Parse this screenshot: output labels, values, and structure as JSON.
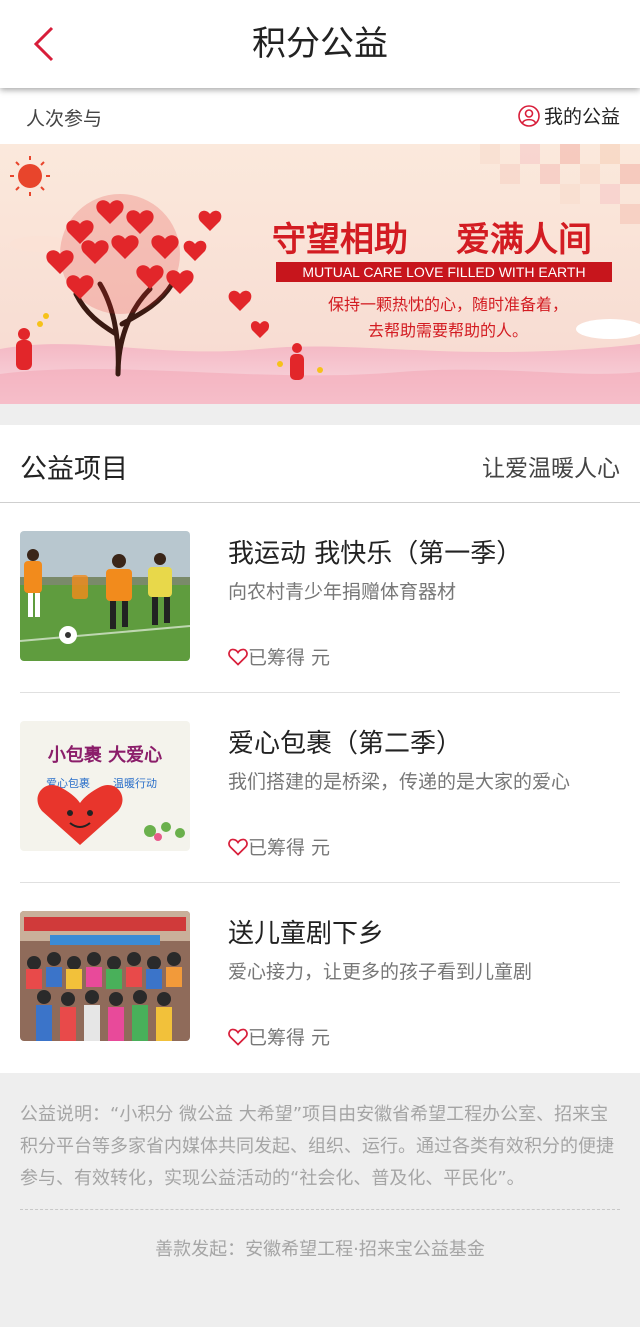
{
  "header": {
    "title": "积分公益",
    "back_icon": "chevron-left-icon",
    "accent_color": "#d81e3a"
  },
  "subbar": {
    "participants_label": "人次参与",
    "my_charity_label": "我的公益",
    "my_charity_icon": "user-icon"
  },
  "banner": {
    "headline_1": "守望相助",
    "headline_2": "爱满人间",
    "english_line": "MUTUAL CARE LOVE FILLED WITH EARTH",
    "tagline_1": "保持一颗热忱的心，随时准备着，",
    "tagline_2": "去帮助需要帮助的人。"
  },
  "projects": {
    "section_title": "公益项目",
    "slogan": "让爱温暖人心",
    "items": [
      {
        "title": "我运动 我快乐（第一季）",
        "desc": "向农村青少年捐赠体育器材",
        "raised_label": "已筹得",
        "unit": "元",
        "heart_icon": "heart-outline-icon"
      },
      {
        "title": "爱心包裹（第二季）",
        "desc": "我们搭建的是桥梁，传递的是大家的爱心",
        "raised_label": "已筹得",
        "unit": "元",
        "heart_icon": "heart-outline-icon",
        "thumb_text_1": "小包裹 大爱心",
        "thumb_text_2": "爱心包裹",
        "thumb_text_3": "温暖行动"
      },
      {
        "title": "送儿童剧下乡",
        "desc": "爱心接力，让更多的孩子看到儿童剧",
        "raised_label": "已筹得",
        "unit": "元",
        "heart_icon": "heart-outline-icon"
      }
    ]
  },
  "footer": {
    "note": "公益说明：“小积分 微公益 大希望”项目由安徽省希望工程办公室、招来宝积分平台等多家省内媒体共同发起、组织、运行。通过各类有效积分的便捷参与、有效转化，实现公益活动的“社会化、普及化、平民化”。",
    "initiator": "善款发起：安徽希望工程·招来宝公益基金"
  }
}
